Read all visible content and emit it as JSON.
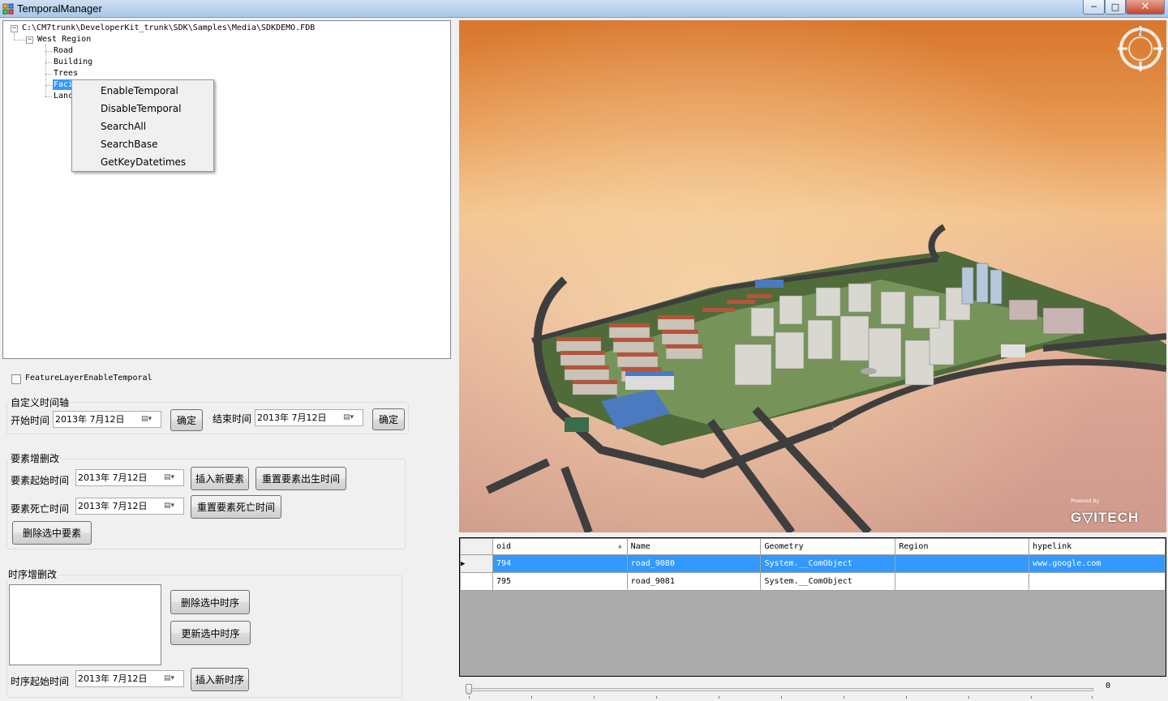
{
  "window": {
    "title": "TemporalManager",
    "min_label": "─",
    "max_label": "□",
    "close_label": "✕"
  },
  "tree": {
    "root": "C:\\CM7trunk\\DeveloperKit_trunk\\SDK\\Samples\\Media\\SDKDEMO.FDB",
    "region": "West Region",
    "layers": [
      "Road",
      "Building",
      "Trees",
      "Faci",
      "Lanc"
    ]
  },
  "context_menu": [
    "EnableTemporal",
    "DisableTemporal",
    "SearchAll",
    "SearchBase",
    "GetKeyDatetimes"
  ],
  "feature_layer_checkbox": {
    "label": "FeatureLayerEnableTemporal",
    "checked": false
  },
  "custom_timeline": {
    "title": "自定义时间轴",
    "start_label": "开始时间",
    "start_value": "2013年  7月12日",
    "confirm1": "确定",
    "end_label": "结束时间",
    "end_value": "2013年  7月12日",
    "confirm2": "确定"
  },
  "feature_edit": {
    "title": "要素增删改",
    "start_label": "要素起始时间",
    "start_value": "2013年  7月12日",
    "insert_btn": "插入新要素",
    "reset_birth_btn": "重置要素出生时间",
    "death_label": "要素死亡时间",
    "death_value": "2013年  7月12日",
    "reset_death_btn": "重置要素死亡时间",
    "delete_btn": "删除选中要素"
  },
  "sequence_edit": {
    "title": "时序增删改",
    "delete_btn": "删除选中时序",
    "update_btn": "更新选中时序",
    "start_label": "时序起始时间",
    "start_value": "2013年  7月12日",
    "insert_btn": "插入新时序"
  },
  "viewer": {
    "brand": "G▽ITECH",
    "powered": "Powered By",
    "compass": "N"
  },
  "grid": {
    "columns": [
      "oid",
      "Name",
      "Geometry",
      "Region",
      "hypelink"
    ],
    "rows": [
      {
        "oid": "794",
        "name": "road_9080",
        "geometry": "System.__ComObject",
        "region": "",
        "link": "www.google.com",
        "selected": true
      },
      {
        "oid": "795",
        "name": "road_9081",
        "geometry": "System.__ComObject",
        "region": "",
        "link": "",
        "selected": false
      }
    ]
  },
  "slider": {
    "value": "0",
    "position_fraction": 0
  }
}
